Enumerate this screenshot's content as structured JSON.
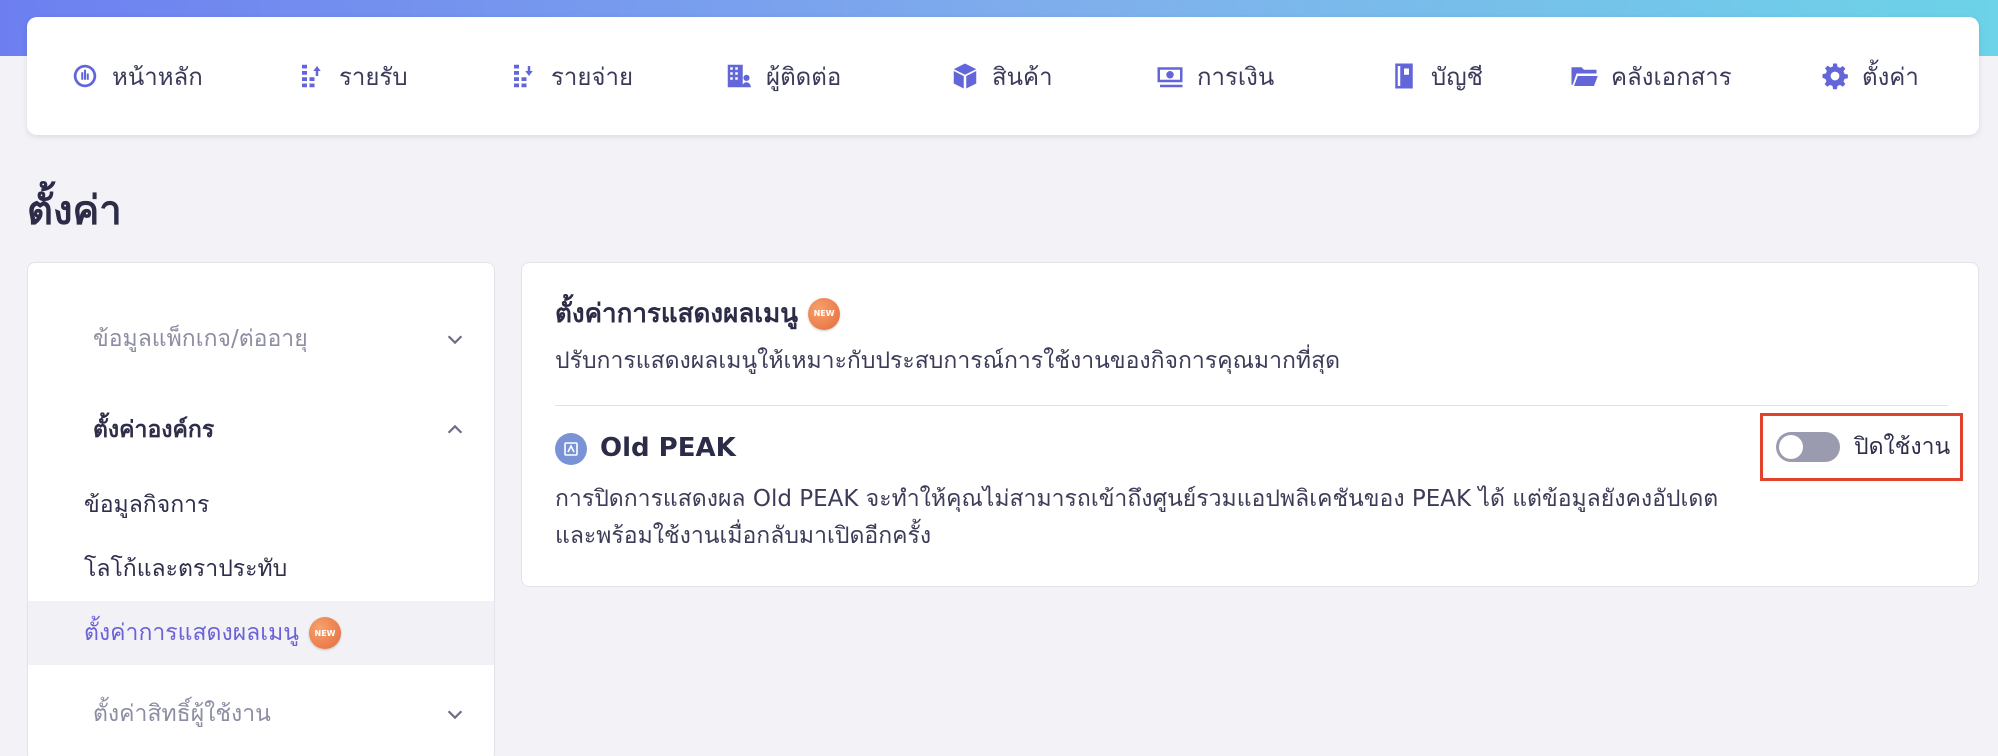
{
  "nav": {
    "items": [
      {
        "label": "หน้าหลัก",
        "icon": "dashboard-icon"
      },
      {
        "label": "รายรับ",
        "icon": "income-icon"
      },
      {
        "label": "รายจ่าย",
        "icon": "expense-icon"
      },
      {
        "label": "ผู้ติดต่อ",
        "icon": "contacts-icon"
      },
      {
        "label": "สินค้า",
        "icon": "box-icon"
      },
      {
        "label": "การเงิน",
        "icon": "money-icon"
      },
      {
        "label": "บัญชี",
        "icon": "ledger-icon"
      },
      {
        "label": "คลังเอกสาร",
        "icon": "folder-icon"
      },
      {
        "label": "ตั้งค่า",
        "icon": "gear-icon"
      }
    ]
  },
  "page": {
    "title": "ตั้งค่า"
  },
  "sidebar": {
    "groups": [
      {
        "label": "ข้อมูลแพ็กเกจ/ต่ออายุ",
        "expanded": false
      },
      {
        "label": "ตั้งค่าองค์กร",
        "expanded": true
      },
      {
        "label": "ตั้งค่าสิทธิ์ผู้ใช้งาน",
        "expanded": false
      }
    ],
    "items": [
      {
        "label": "ข้อมูลกิจการ"
      },
      {
        "label": "โลโก้และตราประทับ"
      },
      {
        "label": "ตั้งค่าการแสดงผลเมนู",
        "active": true,
        "badge": "NEW"
      }
    ]
  },
  "panel": {
    "title": "ตั้งค่าการแสดงผลเมนู",
    "badge": "NEW",
    "subtitle": "ปรับการแสดงผลเมนูให้เหมาะกับประสบการณ์การใช้งานของกิจการคุณมากที่สุด",
    "feature": {
      "name": "Old PEAK",
      "description": "การปิดการแสดงผล Old PEAK จะทำให้คุณไม่สามารถเข้าถึงศูนย์รวมแอปพลิเคชันของ PEAK ได้ แต่ข้อมูลยังคงอัปเดตและพร้อมใช้งานเมื่อกลับมาเปิดอีกครั้ง",
      "toggle_label": "ปิดใช้งาน",
      "enabled": false
    }
  },
  "colors": {
    "accent": "#6366d8",
    "active_text": "#6b62d8",
    "highlight_box": "#e2412b",
    "badge": "#e46a3d"
  }
}
